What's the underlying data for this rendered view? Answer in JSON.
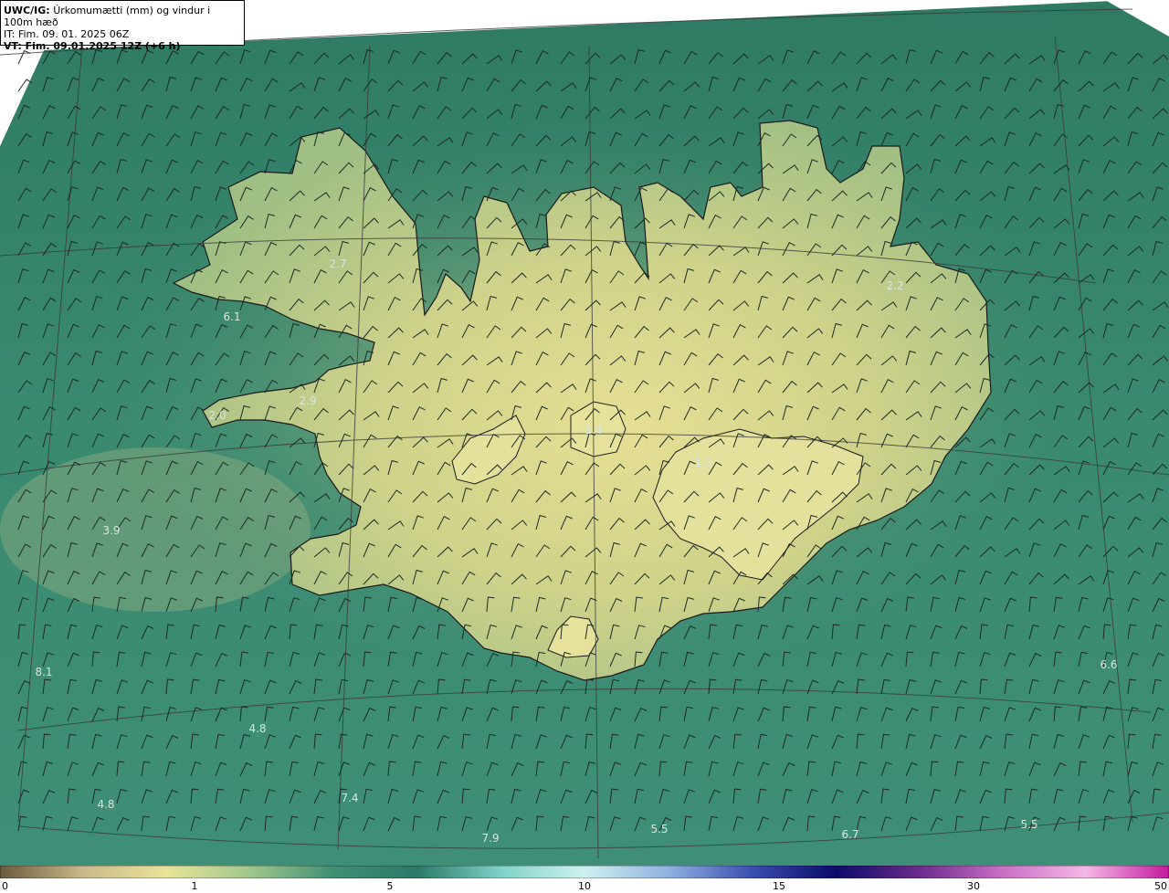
{
  "header": {
    "prefix": "UWC/IG:",
    "title": "Úrkomumætti (mm) og vindur i 100m hæð",
    "it_line": "IT: Fim. 09. 01. 2025 06Z",
    "vt_line": "VT: Fim. 09.01.2025 12Z (+6 h)"
  },
  "colors": {
    "ocean_low": "#2f7a63",
    "ocean_mid": "#3f8f74",
    "land_high": "#d9d68c",
    "coast": "#1a1a1a",
    "barb": "#1c2a24",
    "grid": "#3a3a3a"
  },
  "value_labels": [
    {
      "text": "6.1"
    },
    {
      "text": "2.7"
    },
    {
      "text": "2.9"
    },
    {
      "text": "2.0"
    },
    {
      "text": "3.9"
    },
    {
      "text": "1.4"
    },
    {
      "text": "1.3"
    },
    {
      "text": "2.2"
    },
    {
      "text": "6.6"
    },
    {
      "text": "8.1"
    },
    {
      "text": "4.8"
    },
    {
      "text": "4.8"
    },
    {
      "text": "7.4"
    },
    {
      "text": "7.9"
    },
    {
      "text": "5.5"
    },
    {
      "text": "6.7"
    },
    {
      "text": "5.5"
    }
  ],
  "colorbar": {
    "ticks": [
      "0",
      "1",
      "5",
      "10",
      "15",
      "30",
      "50"
    ],
    "stops": [
      "#6b5a3e",
      "#c9b98a",
      "#e8e39a",
      "#9fc78c",
      "#3e8f73",
      "#2b7a68",
      "#7fd2c8",
      "#cdf1f0",
      "#8fb2df",
      "#3a4fb0",
      "#0b0b6a",
      "#6a2a8a",
      "#c96fc4",
      "#f3b8e6",
      "#c41a9c"
    ]
  }
}
